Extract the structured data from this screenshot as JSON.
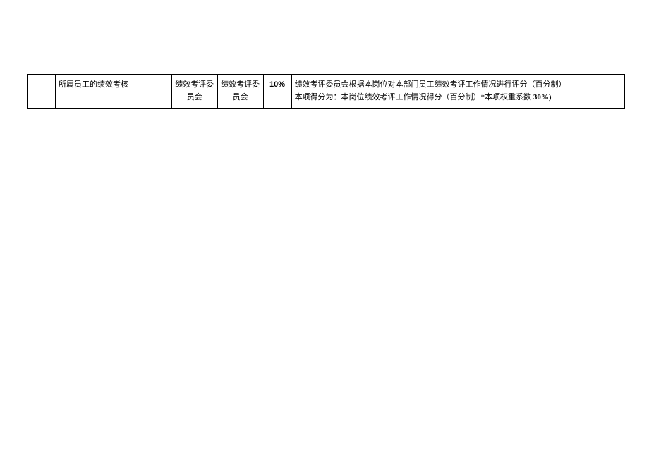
{
  "table": {
    "rows": [
      {
        "col1": "",
        "col2": "所属员工的绩效考核",
        "col3": "绩效考评委员会",
        "col4": "绩效考评委员会",
        "col5": "10%",
        "col6_line1": "绩效考评委员会根据本岗位对本部门员工绩效考评工作情况进行评分（百分制）",
        "col6_line2_prefix": "本项得分为：本岗位绩效考评工作情况得分（百分制）*本项权重系数 ",
        "col6_line2_bold": "30%)"
      }
    ]
  }
}
